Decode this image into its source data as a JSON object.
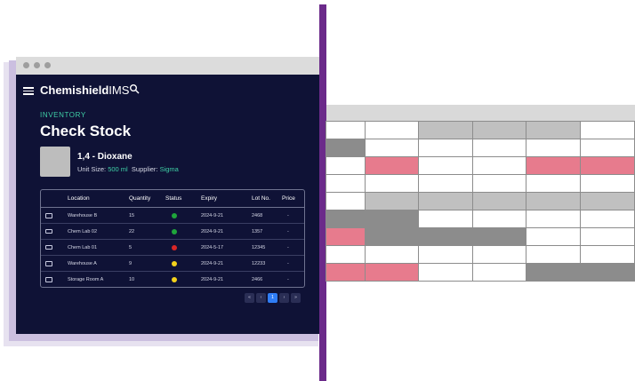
{
  "app": {
    "brand": "Chemishield",
    "brand_suffix": "IMS"
  },
  "page": {
    "section": "INVENTORY",
    "title": "Check Stock"
  },
  "product": {
    "name": "1,4 - Dioxane",
    "unit_size_label": "Unit Size:",
    "unit_size_value": "500 ml",
    "supplier_label": "Supplier:",
    "supplier_value": "Sigma"
  },
  "table": {
    "headers": [
      "Location",
      "Quantity",
      "Status",
      "Expiry",
      "Lot No.",
      "Price"
    ],
    "rows": [
      {
        "location": "Warehouse B",
        "quantity": "15",
        "status": "green",
        "expiry": "2024-9-21",
        "lot": "2468",
        "price": "-"
      },
      {
        "location": "Chem Lab 02",
        "quantity": "22",
        "status": "green",
        "expiry": "2024-9-21",
        "lot": "1357",
        "price": "-"
      },
      {
        "location": "Chem Lab 01",
        "quantity": "5",
        "status": "red",
        "expiry": "2024-5-17",
        "lot": "12345",
        "price": "-"
      },
      {
        "location": "Warehouse A",
        "quantity": "9",
        "status": "yellow",
        "expiry": "2024-9-21",
        "lot": "12233",
        "price": "-"
      },
      {
        "location": "Storage Room A",
        "quantity": "10",
        "status": "yellow",
        "expiry": "2024-9-21",
        "lot": "2466",
        "price": "-"
      }
    ]
  },
  "pagination": {
    "first": "«",
    "prev": "‹",
    "current": "1",
    "next": "›",
    "last": "»"
  },
  "colors": {
    "status_green": "#1fa53b",
    "status_red": "#d92626",
    "status_yellow": "#f4d21c",
    "accent": "#3fcfa6",
    "grid_pink": "#e77b8d",
    "grid_dark": "#8c8c8c",
    "grid_light": "#c0c0c0",
    "grid_empty": "#ffffff"
  },
  "grid": {
    "cells": [
      [
        "empty",
        "empty",
        "light",
        "light",
        "light",
        "empty"
      ],
      [
        "dark",
        "empty",
        "empty",
        "empty",
        "empty",
        "empty"
      ],
      [
        "empty",
        "pink",
        "empty",
        "empty",
        "pink",
        "pink"
      ],
      [
        "empty",
        "empty",
        "empty",
        "empty",
        "empty",
        "empty"
      ],
      [
        "empty",
        "light",
        "light",
        "light",
        "light",
        "light"
      ],
      [
        "dark",
        "dark",
        "empty",
        "empty",
        "empty",
        "empty"
      ],
      [
        "pink",
        "dark",
        "dark",
        "dark",
        "empty",
        "empty"
      ],
      [
        "empty",
        "empty",
        "empty",
        "empty",
        "empty",
        "empty"
      ],
      [
        "pink",
        "pink",
        "empty",
        "empty",
        "dark",
        "dark"
      ]
    ]
  }
}
